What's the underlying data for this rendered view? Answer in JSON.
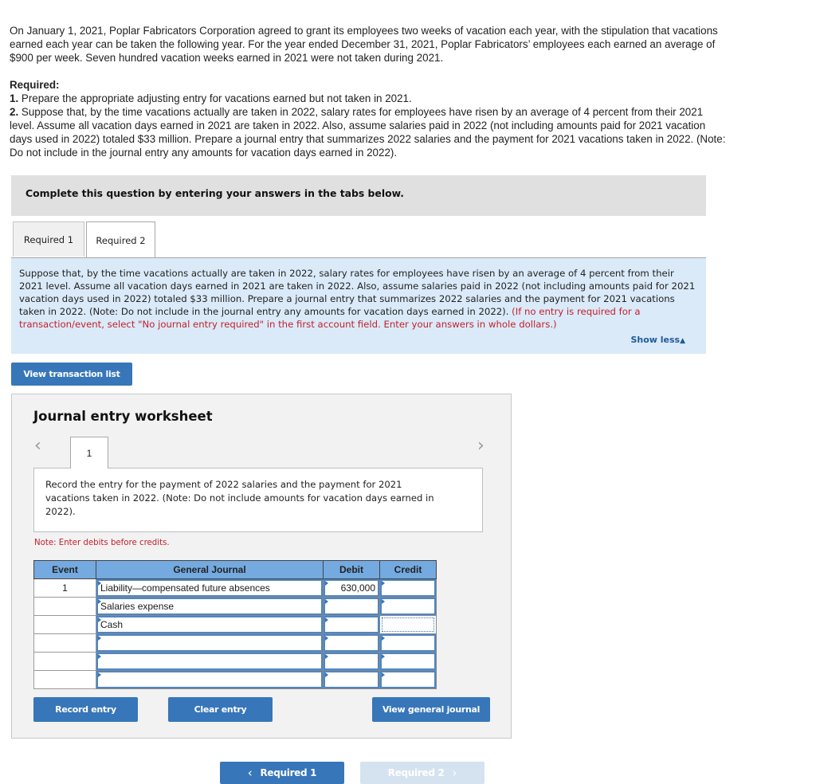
{
  "intro": {
    "paragraph": "On January 1, 2021, Poplar Fabricators Corporation agreed to grant its employees two weeks of vacation each year, with the stipulation that vacations earned each year can be taken the following year. For the year ended December 31, 2021, Poplar Fabricators’ employees each earned an average of $900 per week. Seven hundred vacation weeks earned in 2021 were not taken during 2021.",
    "required_heading": "Required:",
    "req1_num": "1.",
    "req1_text": " Prepare the appropriate adjusting entry for vacations earned but not taken in 2021.",
    "req2_num": "2.",
    "req2_text": " Suppose that, by the time vacations actually are taken in 2022, salary rates for employees have risen by an average of 4 percent from their 2021 level. Assume all vacation days earned in 2021 are taken in 2022. Also, assume salaries paid in 2022 (not including amounts paid for 2021 vacation days used in 2022) totaled $33 million. Prepare a journal entry that summarizes 2022 salaries and the payment for 2021 vacations taken in 2022. (Note: Do not include in the journal entry any amounts for vacation days earned in 2022)."
  },
  "banner": "Complete this question by entering your answers in the tabs below.",
  "tabs": [
    {
      "label": "Required 1",
      "active": false
    },
    {
      "label": "Required 2",
      "active": true
    }
  ],
  "panel": {
    "text": "Suppose that, by the time vacations actually are taken in 2022, salary rates for employees have risen by an average of 4 percent from their 2021 level. Assume all vacation days earned in 2021 are taken in 2022. Also, assume salaries paid in 2022 (not including amounts paid for 2021 vacation days used in 2022) totaled $33 million. Prepare a journal entry that summarizes 2022 salaries and the payment for 2021 vacations taken in 2022. (Note: Do not include in the journal entry any amounts for vacation days earned in 2022).",
    "red_text": " (If no entry is required for a transaction/event, select \"No journal entry required\" in the first account field. Enter your answers in whole dollars.)",
    "show_less": "Show less",
    "show_less_icon": "▲"
  },
  "view_transaction_list": "View transaction list",
  "worksheet": {
    "title": "Journal entry worksheet",
    "prev_icon": "‹",
    "next_icon": "›",
    "entry_tab": "1",
    "instruction": "Record the entry for the payment of 2022 salaries and the payment for 2021 vacations taken in 2022. (Note: Do not include amounts for vacation days earned in 2022).",
    "note": "Note: Enter debits before credits.",
    "columns": [
      "Event",
      "General Journal",
      "Debit",
      "Credit"
    ],
    "rows": [
      {
        "event": "1",
        "account": "Liability—compensated future absences",
        "debit": "630,000",
        "credit": ""
      },
      {
        "event": "",
        "account": "Salaries expense",
        "debit": "",
        "credit": ""
      },
      {
        "event": "",
        "account": "Cash",
        "debit": "",
        "credit": ""
      },
      {
        "event": "",
        "account": "",
        "debit": "",
        "credit": ""
      },
      {
        "event": "",
        "account": "",
        "debit": "",
        "credit": ""
      },
      {
        "event": "",
        "account": "",
        "debit": "",
        "credit": ""
      }
    ],
    "buttons": {
      "record": "Record entry",
      "clear": "Clear entry",
      "view_journal": "View general journal"
    }
  },
  "pagination": {
    "prev_label": "Required 1",
    "prev_icon": "‹",
    "next_label": "Required 2",
    "next_icon": "›"
  },
  "colors": {
    "accent": "#3776b9",
    "header_blue": "#74aae0",
    "panel_bg": "#daeaf8",
    "warning_red": "#c4202b"
  }
}
